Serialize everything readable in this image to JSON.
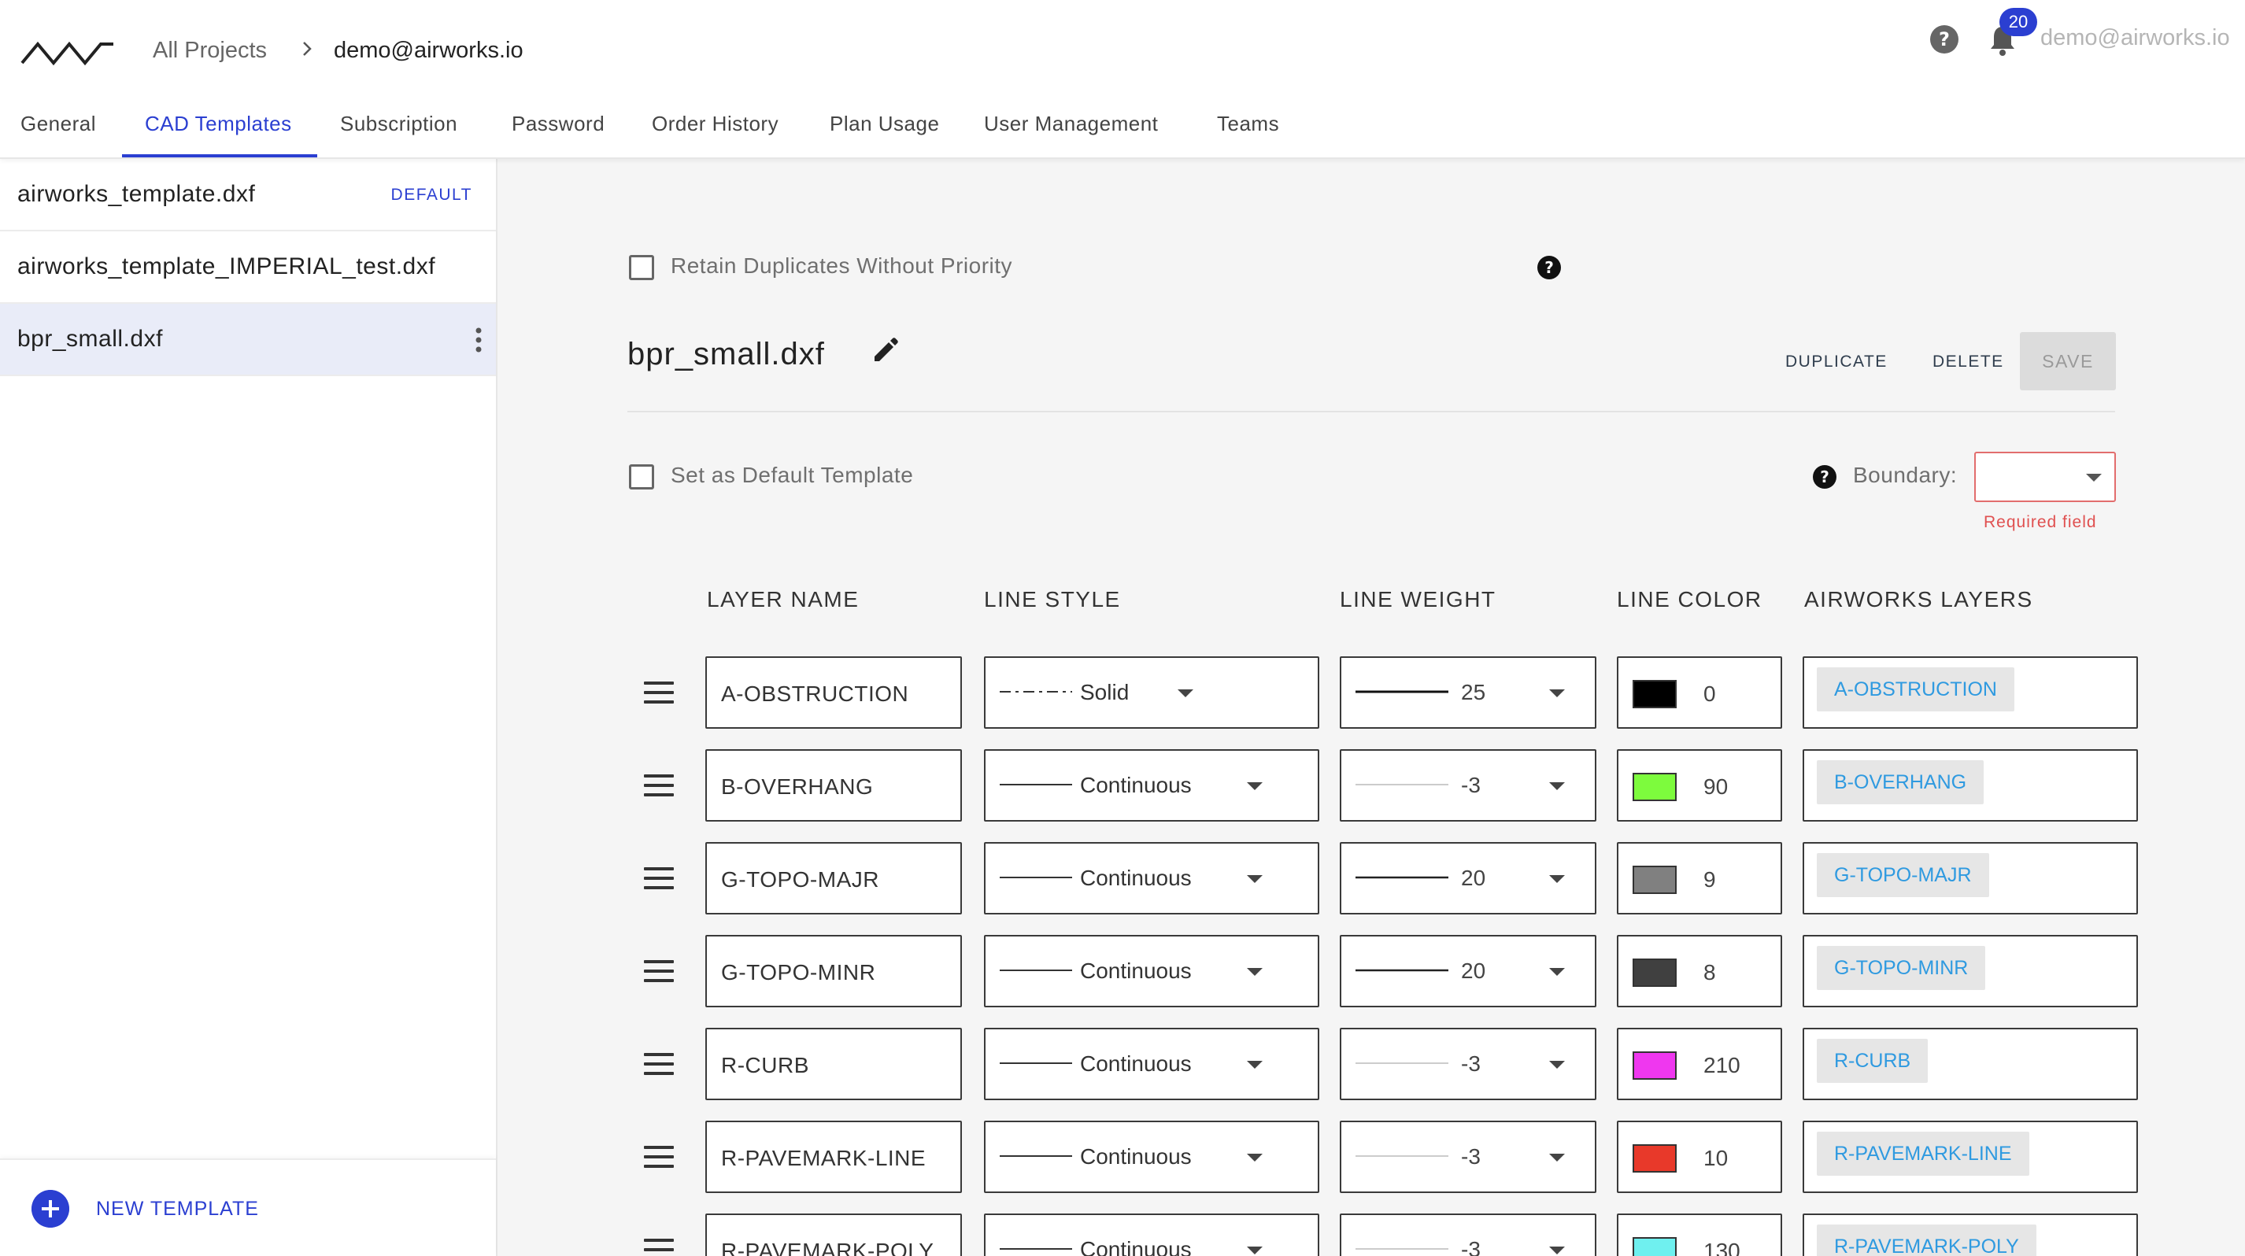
{
  "header": {
    "breadcrumb_all": "All Projects",
    "breadcrumb_user": "demo@airworks.io",
    "notification_count": "20",
    "user_email": "demo@airworks.io",
    "accent_color": "#2b3fd1"
  },
  "tabs": [
    "General",
    "CAD Templates",
    "Subscription",
    "Password",
    "Order History",
    "Plan Usage",
    "User Management",
    "Teams"
  ],
  "active_tab": "CAD Templates",
  "sidebar": {
    "templates": [
      {
        "name": "airworks_template.dxf",
        "badge": "DEFAULT"
      },
      {
        "name": "airworks_template_IMPERIAL_test.dxf",
        "badge": ""
      },
      {
        "name": "bpr_small.dxf",
        "badge": ""
      }
    ],
    "selected": "bpr_small.dxf",
    "new_template_label": "NEW TEMPLATE"
  },
  "editor": {
    "retain_duplicates_label": "Retain Duplicates Without Priority",
    "retain_duplicates_checked": false,
    "title": "bpr_small.dxf",
    "duplicate_label": "DUPLICATE",
    "delete_label": "DELETE",
    "save_label": "SAVE",
    "set_default_label": "Set as Default Template",
    "set_default_checked": false,
    "boundary_label": "Boundary:",
    "boundary_value": "",
    "required_field": "Required field"
  },
  "table": {
    "headers": [
      "LAYER NAME",
      "LINE STYLE",
      "LINE WEIGHT",
      "LINE COLOR",
      "AIRWORKS LAYERS"
    ],
    "rows": [
      {
        "layer": "A-OBSTRUCTION",
        "style": "Solid",
        "weight": "25",
        "color_index": "0",
        "color_hex": "#000000",
        "airworks": "A-OBSTRUCTION"
      },
      {
        "layer": "B-OVERHANG",
        "style": "Continuous",
        "weight": "-3",
        "color_index": "90",
        "color_hex": "#7dfb3d",
        "airworks": "B-OVERHANG"
      },
      {
        "layer": "G-TOPO-MAJR",
        "style": "Continuous",
        "weight": "20",
        "color_index": "9",
        "color_hex": "#808080",
        "airworks": "G-TOPO-MAJR"
      },
      {
        "layer": "G-TOPO-MINR",
        "style": "Continuous",
        "weight": "20",
        "color_index": "8",
        "color_hex": "#404040",
        "airworks": "G-TOPO-MINR"
      },
      {
        "layer": "R-CURB",
        "style": "Continuous",
        "weight": "-3",
        "color_index": "210",
        "color_hex": "#ef37ef",
        "airworks": "R-CURB"
      },
      {
        "layer": "R-PAVEMARK-LINE",
        "style": "Continuous",
        "weight": "-3",
        "color_index": "10",
        "color_hex": "#e8392a",
        "airworks": "R-PAVEMARK-LINE"
      },
      {
        "layer": "R-PAVEMARK-POLY",
        "style": "Continuous",
        "weight": "-3",
        "color_index": "130",
        "color_hex": "#6ff0ef",
        "airworks": "R-PAVEMARK-POLY"
      }
    ]
  }
}
